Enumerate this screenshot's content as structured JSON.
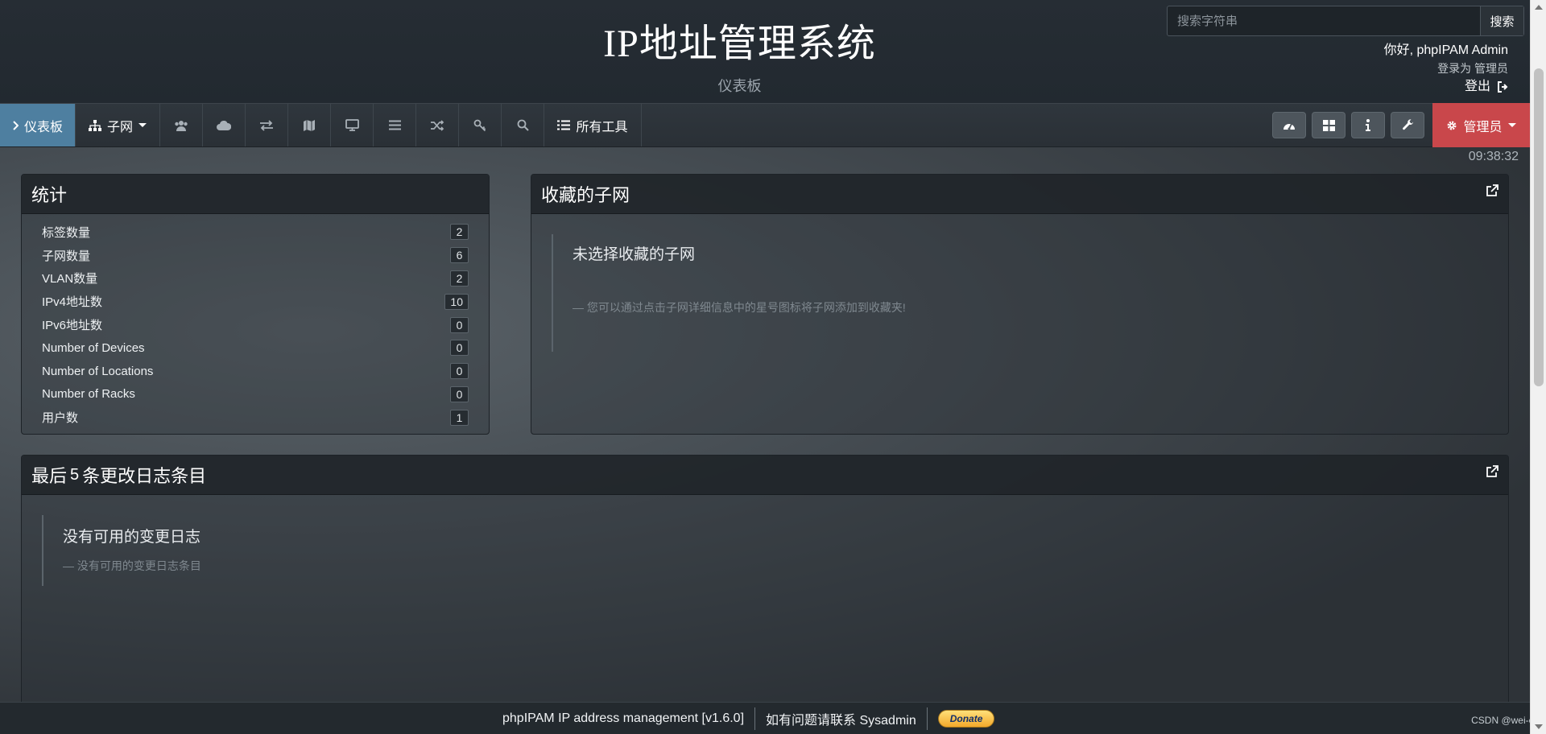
{
  "header": {
    "title": "IP地址管理系统",
    "subtitle": "仪表板",
    "search_placeholder": "搜索字符串",
    "search_button": "搜索",
    "greeting": "你好, phpIPAM Admin",
    "logged_in_as": "登录为  管理员",
    "logout": "登出"
  },
  "nav": {
    "dashboard": "仪表板",
    "subnets": "子网",
    "all_tools": "所有工具",
    "admin": "管理员",
    "icons": [
      "users-icon",
      "cloud-icon",
      "exchange-icon",
      "map-icon",
      "desktop-icon",
      "list-icon",
      "random-icon",
      "key-icon",
      "search-icon"
    ],
    "tool_icons": [
      "dashboard-icon",
      "grid-icon",
      "info-icon",
      "wrench-icon"
    ]
  },
  "clock": "09:38:32",
  "stats": {
    "title": "统计",
    "items": [
      {
        "label": "标签数量",
        "value": "2"
      },
      {
        "label": "子网数量",
        "value": "6"
      },
      {
        "label": "VLAN数量",
        "value": "2"
      },
      {
        "label": "IPv4地址数",
        "value": "10"
      },
      {
        "label": "IPv6地址数",
        "value": "0"
      },
      {
        "label": "Number of Devices",
        "value": "0"
      },
      {
        "label": "Number of Locations",
        "value": "0"
      },
      {
        "label": "Number of Racks",
        "value": "0"
      },
      {
        "label": "用户数",
        "value": "1"
      }
    ]
  },
  "favorites": {
    "title": "收藏的子网",
    "empty_title": "未选择收藏的子网",
    "empty_hint": "— 您可以通过点击子网详细信息中的星号图标将子网添加到收藏夹!"
  },
  "changelog": {
    "title_prefix": "最后",
    "title_count": "5",
    "title_suffix": "条更改日志条目",
    "empty_title": "没有可用的变更日志",
    "empty_hint": "— 没有可用的变更日志条目"
  },
  "footer": {
    "version": "phpIPAM IP address management [v1.6.0]",
    "contact": "如有问题请联系 Sysadmin",
    "donate": "Donate"
  },
  "watermark": "CSDN @wei-coo",
  "colors": {
    "active_nav": "#4e7fa0",
    "admin_button": "#c9474b",
    "header_bg": "#242b32"
  }
}
